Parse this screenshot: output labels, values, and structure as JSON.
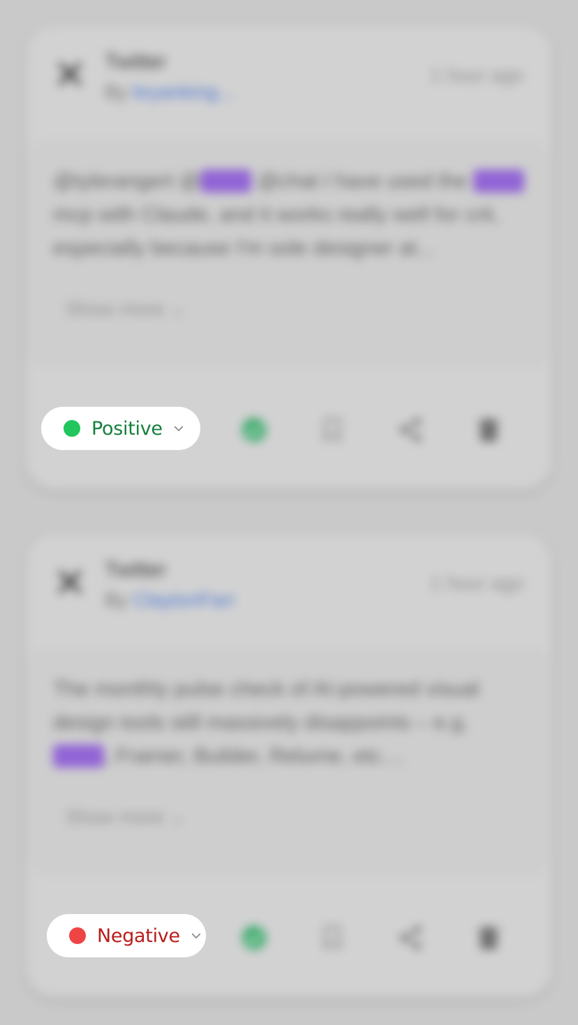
{
  "colors": {
    "positive_dot": "#22c55e",
    "positive_text": "#15803d",
    "negative_dot": "#ef4444",
    "negative_text": "#b91c1c",
    "approve_icon": "#22a35a",
    "link": "#3f6fd8",
    "highlight": "#8c5ad8"
  },
  "cards": [
    {
      "source": "Twitter",
      "by_prefix": "By",
      "author": "bryanking...",
      "time": "1 hour ago",
      "text_parts": [
        "@tylerangert @",
        "figma",
        " @chat I have used the ",
        "figma",
        " mcp with Claude, and it works really well for crit, especially because I'm sole designer at..."
      ],
      "show_more": "Show more ⌄",
      "sentiment": {
        "label": "Positive",
        "icon": "chevron-down-icon"
      },
      "actions": [
        "check-circle-icon",
        "bookmark-icon",
        "share-icon",
        "trash-icon"
      ]
    },
    {
      "source": "Twitter",
      "by_prefix": "By",
      "author": "ClaytonFarr",
      "time": "1 hour ago",
      "text_parts": [
        "The monthly pulse check of AI-powered visual design tools still massively disappoints – e.g. ",
        "figma",
        ", Framer, Builder, Relume, etc...."
      ],
      "show_more": "Show more ⌄",
      "sentiment": {
        "label": "Negative",
        "icon": "chevron-down-icon"
      },
      "actions": [
        "check-circle-icon",
        "bookmark-icon",
        "share-icon",
        "trash-icon"
      ]
    }
  ]
}
